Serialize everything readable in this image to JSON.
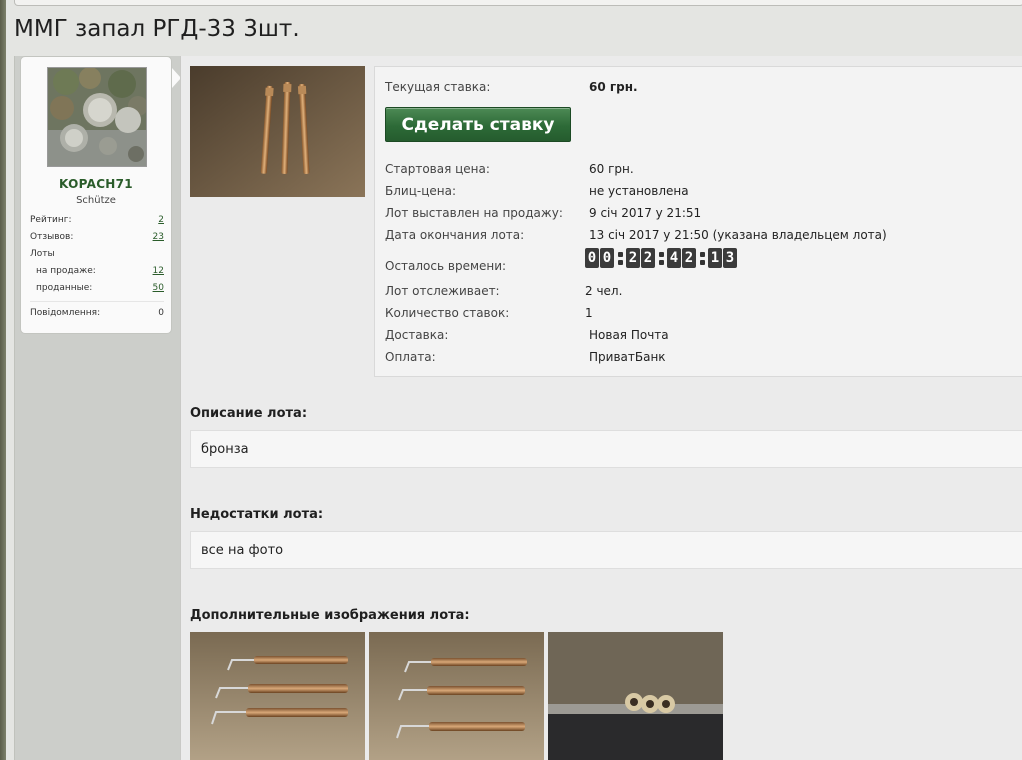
{
  "lot": {
    "title": "ММГ запал РГД-33 3шт."
  },
  "seller": {
    "username": "KOPACH71",
    "rank": "Schütze",
    "stats": {
      "rating_label": "Рейтинг:",
      "rating_value": "2",
      "reviews_label": "Отзывов:",
      "reviews_value": "23",
      "lots_label": "Лоты",
      "on_sale_label": "на продаже:",
      "on_sale_value": "12",
      "sold_label": "проданные:",
      "sold_value": "50",
      "messages_label": "Повідомлення:",
      "messages_value": "0"
    }
  },
  "auction": {
    "current_bid_label": "Текущая ставка:",
    "current_bid_value": "60 грн.",
    "bid_button_label": "Сделать ставку",
    "start_price_label": "Стартовая цена:",
    "start_price_value": "60 грн.",
    "blitz_price_label": "Блиц-цена:",
    "blitz_price_value": "не установлена",
    "listed_label": "Лот выставлен на продажу:",
    "listed_value": "9 січ 2017 у 21:51",
    "end_label": "Дата окончания лота:",
    "end_value": "13 січ 2017 у 21:50 (указана владельцем лота)",
    "time_left_label": "Осталось времени:",
    "timer": {
      "d1": "0",
      "d2": "0",
      "h1": "2",
      "h2": "2",
      "m1": "4",
      "m2": "2",
      "s1": "1",
      "s2": "3"
    },
    "watchers_label": "Лот отслеживает:",
    "watchers_value": "2 чел.",
    "bids_count_label": "Количество ставок:",
    "bids_count_value": "1",
    "delivery_label": "Доставка:",
    "delivery_value": "Новая Почта",
    "payment_label": "Оплата:",
    "payment_value": "ПриватБанк"
  },
  "description": {
    "heading": "Описание лота:",
    "text": "бронза"
  },
  "defects": {
    "heading": "Недостатки лота:",
    "text": "все на фото"
  },
  "extra_images": {
    "heading": "Дополнительные изображения лота:"
  },
  "colors": {
    "accent_green": "#2d6a37",
    "username_green": "#2a5c2a",
    "background": "#e4e5e2"
  }
}
